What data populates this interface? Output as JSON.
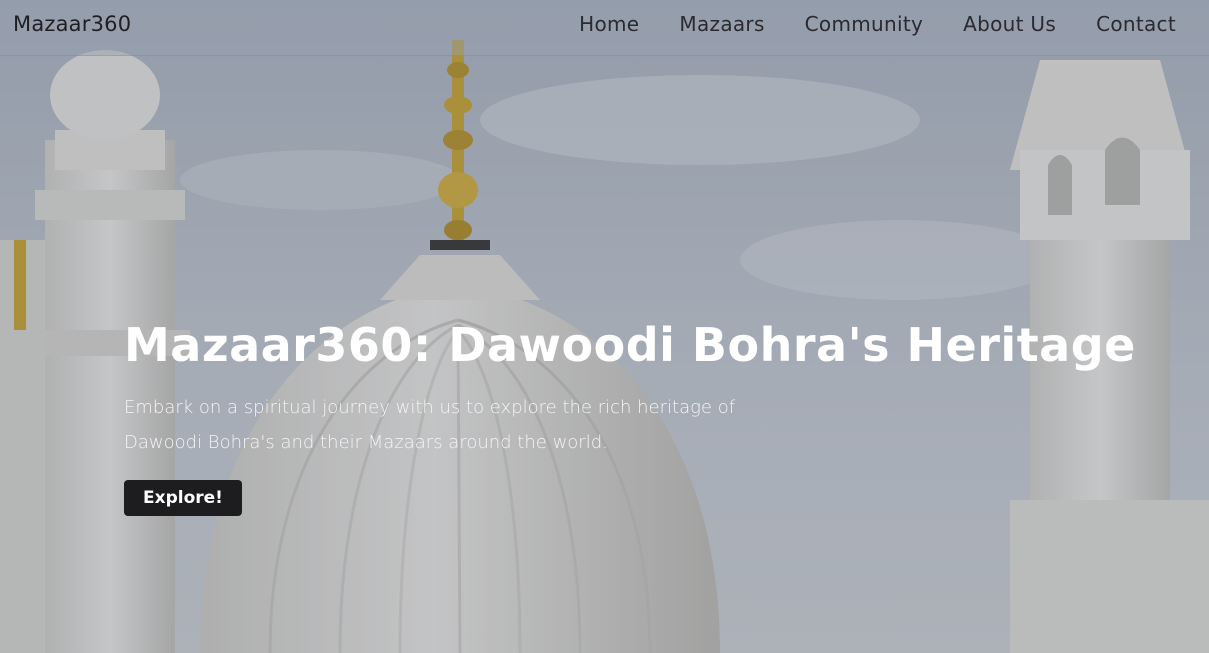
{
  "nav": {
    "brand": "Mazaar360",
    "links": [
      {
        "label": "Home"
      },
      {
        "label": "Mazaars"
      },
      {
        "label": "Community"
      },
      {
        "label": "About Us"
      },
      {
        "label": "Contact"
      }
    ]
  },
  "hero": {
    "title": "Mazaar360: Dawoodi Bohra's Heritage",
    "subtitle": "Embark on a spiritual journey with us to explore the rich heritage of Dawoodi Bohra's and their Mazaars around the world.",
    "button_label": "Explore!"
  },
  "colors": {
    "sky": "#b9c1cc",
    "marble": "#e4e2de",
    "gold": "#c9a227",
    "button": "#1d1d1f",
    "title_text": "#ffffff"
  }
}
